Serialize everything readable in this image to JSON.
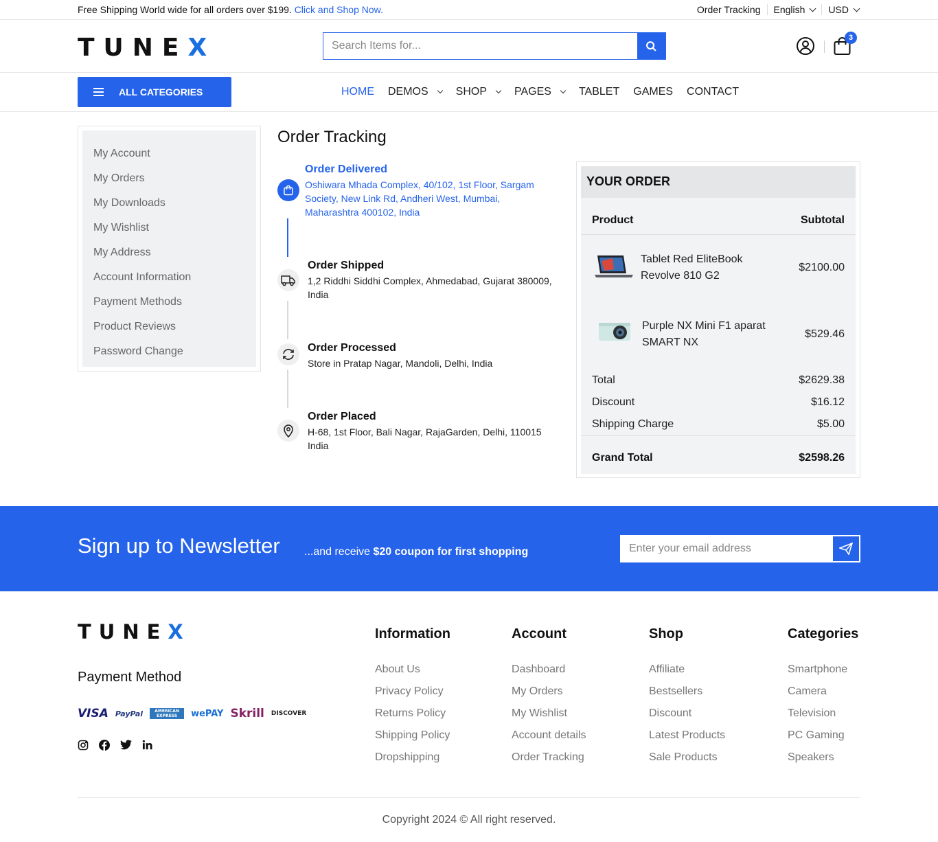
{
  "topbar": {
    "promo": "Free Shipping World wide for all orders over $199.",
    "promo_link": "Click and Shop Now.",
    "order_tracking": "Order Tracking",
    "language": "English",
    "currency": "USD"
  },
  "header": {
    "logo_main": "TUNE",
    "logo_x": "X",
    "search_placeholder": "Search Items for...",
    "cart_count": "3"
  },
  "nav": {
    "all_categories": "ALL CATEGORIES",
    "items": [
      {
        "label": "HOME",
        "active": true,
        "dropdown": false
      },
      {
        "label": "DEMOS",
        "dropdown": true
      },
      {
        "label": "SHOP",
        "dropdown": true
      },
      {
        "label": "PAGES",
        "dropdown": true
      },
      {
        "label": "TABLET",
        "dropdown": false
      },
      {
        "label": "GAMES",
        "dropdown": false
      },
      {
        "label": "CONTACT",
        "dropdown": false
      }
    ]
  },
  "sidebar": {
    "items": [
      "My Account",
      "My Orders",
      "My Downloads",
      "My Wishlist",
      "My Address",
      "Account Information",
      "Payment Methods",
      "Product Reviews",
      "Password Change"
    ]
  },
  "tracking": {
    "title": "Order Tracking",
    "steps": [
      {
        "title": "Order Delivered",
        "address": "Oshiwara Mhada Complex, 40/102, 1st Floor, Sargam Society, New Link Rd, Andheri West, Mumbai, Maharashtra 400102, India",
        "icon": "shopping-bag-icon",
        "active": true
      },
      {
        "title": "Order Shipped",
        "address": "1,2 Riddhi Siddhi Complex, Ahmedabad, Gujarat 380009, India",
        "icon": "truck-icon"
      },
      {
        "title": "Order Processed",
        "address": "Store in Pratap Nagar, Mandoli, Delhi, India",
        "icon": "refresh-icon"
      },
      {
        "title": "Order Placed",
        "address": "H-68, 1st Floor, Bali Nagar, RajaGarden, Delhi, 110015 India",
        "icon": "map-pin-icon"
      }
    ]
  },
  "order": {
    "heading": "YOUR ORDER",
    "col_product": "Product",
    "col_subtotal": "Subtotal",
    "products": [
      {
        "name_line1": "Tablet Red EliteBook",
        "name_line2": "Revolve 810 G2",
        "price": "$2100.00"
      },
      {
        "name_line1": "Purple NX Mini F1 aparat",
        "name_line2": "SMART NX",
        "price": "$529.46"
      }
    ],
    "total_label": "Total",
    "total": "$2629.38",
    "discount_label": "Discount",
    "discount": "$16.12",
    "shipping_label": "Shipping Charge",
    "shipping": "$5.00",
    "grand_label": "Grand Total",
    "grand": "$2598.26"
  },
  "newsletter": {
    "title": "Sign up to Newsletter",
    "sub_prefix": "...and receive ",
    "sub_bold": "$20 coupon for first shopping",
    "placeholder": "Enter your email address"
  },
  "footer": {
    "payment_title": "Payment Method",
    "payment_logos": [
      "VISA",
      "PayPal",
      "AMERICAN EXPRESS",
      "wePAY",
      "Skrill",
      "DISCOVER"
    ],
    "columns": [
      {
        "title": "Information",
        "links": [
          "About Us",
          "Privacy Policy",
          "Returns Policy",
          "Shipping Policy",
          "Dropshipping"
        ]
      },
      {
        "title": "Account",
        "links": [
          "Dashboard",
          "My Orders",
          "My Wishlist",
          "Account details",
          "Order Tracking"
        ]
      },
      {
        "title": "Shop",
        "links": [
          "Affiliate",
          "Bestsellers",
          "Discount",
          "Latest Products",
          "Sale Products"
        ]
      },
      {
        "title": "Categories",
        "links": [
          "Smartphone",
          "Camera",
          "Television",
          "PC Gaming",
          "Speakers"
        ]
      }
    ],
    "copyright": "Copyright 2024 © All right reserved."
  },
  "colors": {
    "accent": "#2563eb",
    "logo_x": "#1a6fe0"
  }
}
